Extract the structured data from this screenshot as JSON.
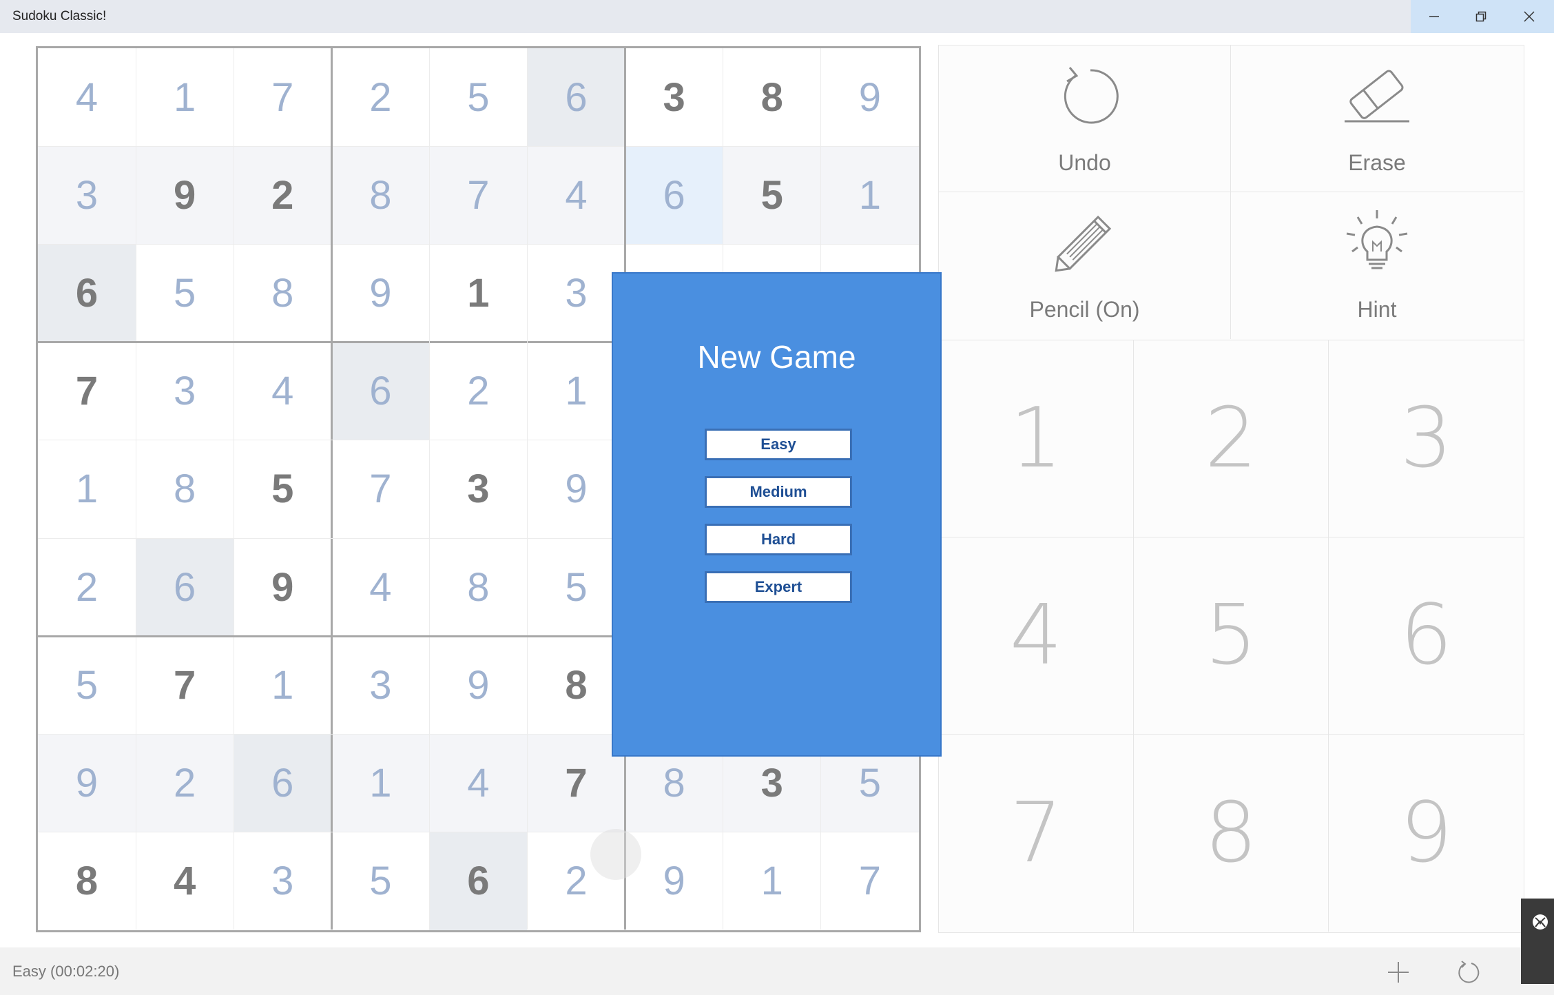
{
  "app": {
    "title": "Sudoku Classic!"
  },
  "board": {
    "rows": [
      [
        {
          "v": "4",
          "g": false
        },
        {
          "v": "1",
          "g": false
        },
        {
          "v": "7",
          "g": false
        },
        {
          "v": "2",
          "g": false
        },
        {
          "v": "5",
          "g": false
        },
        {
          "v": "6",
          "g": false
        },
        {
          "v": "3",
          "g": true
        },
        {
          "v": "8",
          "g": true
        },
        {
          "v": "9",
          "g": false
        }
      ],
      [
        {
          "v": "3",
          "g": false
        },
        {
          "v": "9",
          "g": true
        },
        {
          "v": "2",
          "g": true
        },
        {
          "v": "8",
          "g": false
        },
        {
          "v": "7",
          "g": false
        },
        {
          "v": "4",
          "g": false
        },
        {
          "v": "6",
          "g": false
        },
        {
          "v": "5",
          "g": true
        },
        {
          "v": "1",
          "g": false
        }
      ],
      [
        {
          "v": "6",
          "g": true
        },
        {
          "v": "5",
          "g": false
        },
        {
          "v": "8",
          "g": false
        },
        {
          "v": "9",
          "g": false
        },
        {
          "v": "1",
          "g": true
        },
        {
          "v": "3",
          "g": false
        },
        {
          "v": "",
          "g": false
        },
        {
          "v": "",
          "g": false
        },
        {
          "v": "",
          "g": false
        }
      ],
      [
        {
          "v": "7",
          "g": true
        },
        {
          "v": "3",
          "g": false
        },
        {
          "v": "4",
          "g": false
        },
        {
          "v": "6",
          "g": false
        },
        {
          "v": "2",
          "g": false
        },
        {
          "v": "1",
          "g": false
        },
        {
          "v": "",
          "g": false
        },
        {
          "v": "",
          "g": false
        },
        {
          "v": "",
          "g": false
        }
      ],
      [
        {
          "v": "1",
          "g": false
        },
        {
          "v": "8",
          "g": false
        },
        {
          "v": "5",
          "g": true
        },
        {
          "v": "7",
          "g": false
        },
        {
          "v": "3",
          "g": true
        },
        {
          "v": "9",
          "g": false
        },
        {
          "v": "",
          "g": false
        },
        {
          "v": "",
          "g": false
        },
        {
          "v": "",
          "g": false
        }
      ],
      [
        {
          "v": "2",
          "g": false
        },
        {
          "v": "6",
          "g": false
        },
        {
          "v": "9",
          "g": true
        },
        {
          "v": "4",
          "g": false
        },
        {
          "v": "8",
          "g": false
        },
        {
          "v": "5",
          "g": false
        },
        {
          "v": "",
          "g": false
        },
        {
          "v": "",
          "g": false
        },
        {
          "v": "",
          "g": false
        }
      ],
      [
        {
          "v": "5",
          "g": false
        },
        {
          "v": "7",
          "g": true
        },
        {
          "v": "1",
          "g": false
        },
        {
          "v": "3",
          "g": false
        },
        {
          "v": "9",
          "g": false
        },
        {
          "v": "8",
          "g": true
        },
        {
          "v": "",
          "g": false
        },
        {
          "v": "",
          "g": false
        },
        {
          "v": "",
          "g": false
        }
      ],
      [
        {
          "v": "9",
          "g": false
        },
        {
          "v": "2",
          "g": false
        },
        {
          "v": "6",
          "g": false
        },
        {
          "v": "1",
          "g": false
        },
        {
          "v": "4",
          "g": false
        },
        {
          "v": "7",
          "g": true
        },
        {
          "v": "8",
          "g": false
        },
        {
          "v": "3",
          "g": true
        },
        {
          "v": "5",
          "g": false
        }
      ],
      [
        {
          "v": "8",
          "g": true
        },
        {
          "v": "4",
          "g": true
        },
        {
          "v": "3",
          "g": false
        },
        {
          "v": "5",
          "g": false
        },
        {
          "v": "6",
          "g": true
        },
        {
          "v": "2",
          "g": false
        },
        {
          "v": "9",
          "g": false
        },
        {
          "v": "1",
          "g": false
        },
        {
          "v": "7",
          "g": false
        }
      ]
    ],
    "shaded_cells": [
      [
        0,
        5
      ],
      [
        2,
        0
      ],
      [
        3,
        3
      ],
      [
        5,
        1
      ],
      [
        7,
        2
      ],
      [
        8,
        4
      ]
    ],
    "light_rows": [
      1,
      7
    ],
    "highlight_cell": [
      1,
      6
    ],
    "colors": {
      "given": "#7a7a7a",
      "entered": "#9fb2d0",
      "shade": "#e9ecf0",
      "light": "#f4f5f8",
      "highlight": "#e6f0fb"
    }
  },
  "tools": {
    "undo": {
      "label": "Undo",
      "icon": "undo-icon"
    },
    "erase": {
      "label": "Erase",
      "icon": "eraser-icon"
    },
    "pencil": {
      "label": "Pencil (On)",
      "icon": "pencil-icon"
    },
    "hint": {
      "label": "Hint",
      "icon": "lightbulb-icon"
    }
  },
  "numpad": [
    "1",
    "2",
    "3",
    "4",
    "5",
    "6",
    "7",
    "8",
    "9"
  ],
  "dialog": {
    "title": "New Game",
    "buttons": [
      "Easy",
      "Medium",
      "Hard",
      "Expert"
    ],
    "color": "#4a8fe0"
  },
  "status": {
    "text": "Easy (00:02:20)"
  },
  "statusbar_buttons": {
    "new": "plus-icon",
    "restart": "restart-icon"
  }
}
